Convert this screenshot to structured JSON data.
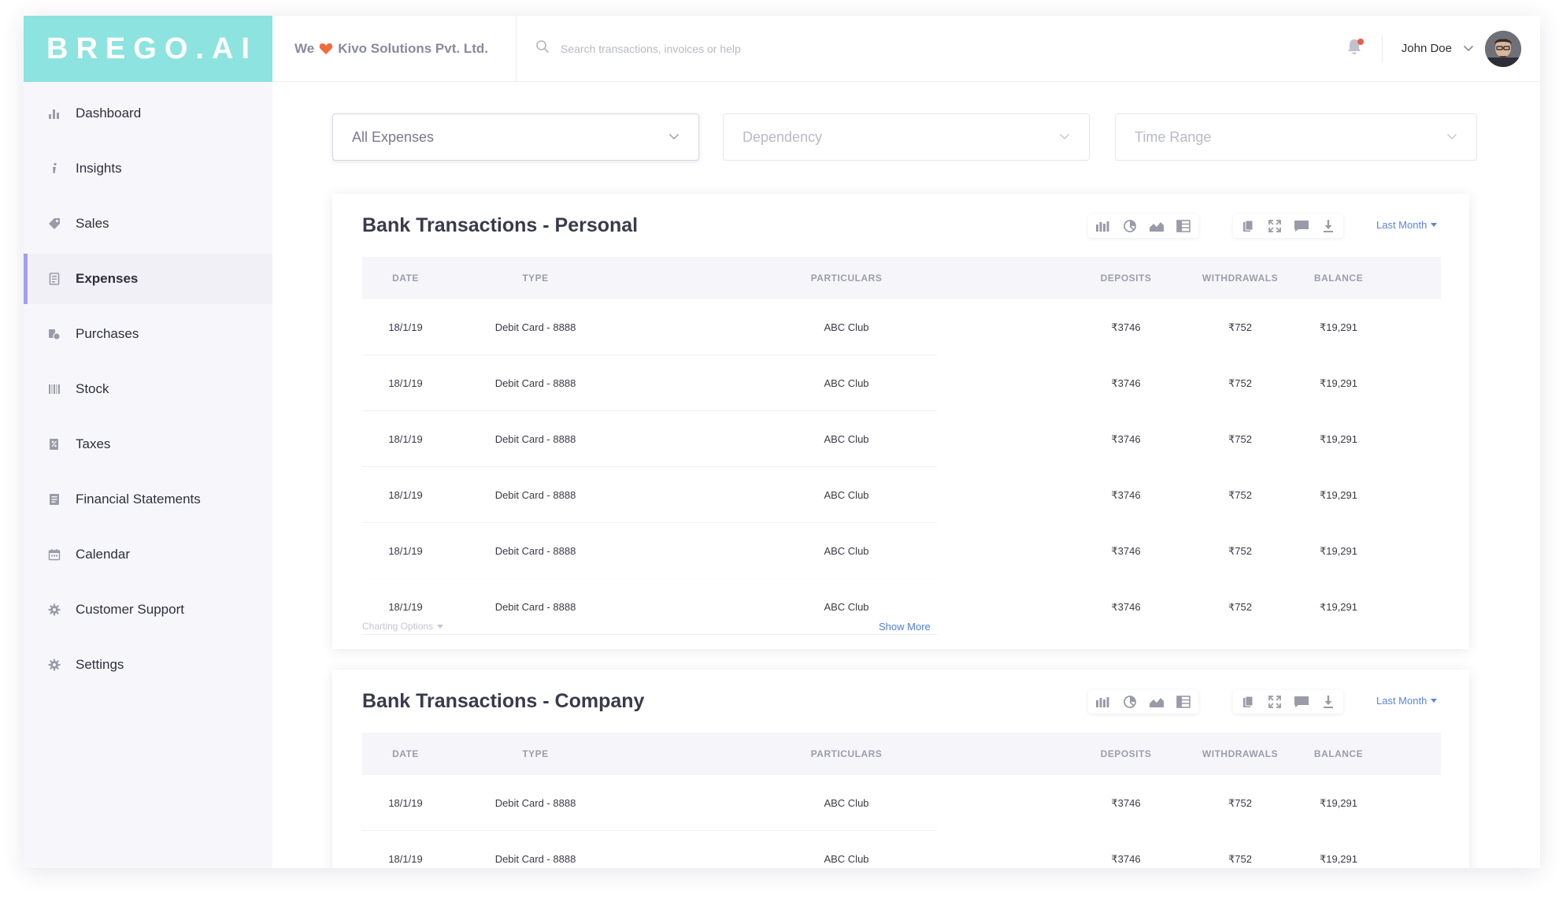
{
  "brand": {
    "logo_text": "BREGO.AI"
  },
  "header": {
    "company_prefix": "We",
    "company_name": "Kivo Solutions Pvt. Ltd.",
    "search_placeholder": "Search transactions, invoices or help",
    "user_name": "John Doe",
    "notification_dot_color": "#f0584a"
  },
  "sidebar": {
    "accent_color": "#a59fe8",
    "items": [
      {
        "label": "Dashboard",
        "icon": "bar-chart-icon"
      },
      {
        "label": "Insights",
        "icon": "info-icon"
      },
      {
        "label": "Sales",
        "icon": "tag-icon"
      },
      {
        "label": "Expenses",
        "icon": "receipt-icon",
        "active": true
      },
      {
        "label": "Purchases",
        "icon": "coins-icon"
      },
      {
        "label": "Stock",
        "icon": "barcode-icon"
      },
      {
        "label": "Taxes",
        "icon": "tax-document-icon"
      },
      {
        "label": "Financial Statements",
        "icon": "statement-icon"
      },
      {
        "label": "Calendar",
        "icon": "calendar-icon"
      },
      {
        "label": "Customer Support",
        "icon": "gear-icon"
      },
      {
        "label": "Settings",
        "icon": "gear-icon"
      }
    ]
  },
  "filters": {
    "expense_type": "All Expenses",
    "dependency": "Dependency",
    "time_range": "Time Range"
  },
  "columns": [
    "DATE",
    "TYPE",
    "PARTICULARS",
    "DEPOSITS",
    "WITHDRAWALS",
    "BALANCE"
  ],
  "cards": [
    {
      "title": "Bank Transactions - Personal",
      "period": "Last Month",
      "charting_options": "Charting Options",
      "show_more": "Show More",
      "rows": [
        {
          "date": "18/1/19",
          "type": "Debit Card - 8888",
          "particulars": "ABC Club",
          "deposits": "₹3746",
          "withdrawals": "₹752",
          "balance": "₹19,291"
        },
        {
          "date": "18/1/19",
          "type": "Debit Card - 8888",
          "particulars": "ABC Club",
          "deposits": "₹3746",
          "withdrawals": "₹752",
          "balance": "₹19,291"
        },
        {
          "date": "18/1/19",
          "type": "Debit Card - 8888",
          "particulars": "ABC Club",
          "deposits": "₹3746",
          "withdrawals": "₹752",
          "balance": "₹19,291"
        },
        {
          "date": "18/1/19",
          "type": "Debit Card - 8888",
          "particulars": "ABC Club",
          "deposits": "₹3746",
          "withdrawals": "₹752",
          "balance": "₹19,291"
        },
        {
          "date": "18/1/19",
          "type": "Debit Card - 8888",
          "particulars": "ABC Club",
          "deposits": "₹3746",
          "withdrawals": "₹752",
          "balance": "₹19,291"
        },
        {
          "date": "18/1/19",
          "type": "Debit Card - 8888",
          "particulars": "ABC Club",
          "deposits": "₹3746",
          "withdrawals": "₹752",
          "balance": "₹19,291"
        }
      ]
    },
    {
      "title": "Bank Transactions - Company",
      "period": "Last Month",
      "rows": [
        {
          "date": "18/1/19",
          "type": "Debit Card - 8888",
          "particulars": "ABC Club",
          "deposits": "₹3746",
          "withdrawals": "₹752",
          "balance": "₹19,291"
        },
        {
          "date": "18/1/19",
          "type": "Debit Card - 8888",
          "particulars": "ABC Club",
          "deposits": "₹3746",
          "withdrawals": "₹752",
          "balance": "₹19,291"
        }
      ]
    }
  ]
}
